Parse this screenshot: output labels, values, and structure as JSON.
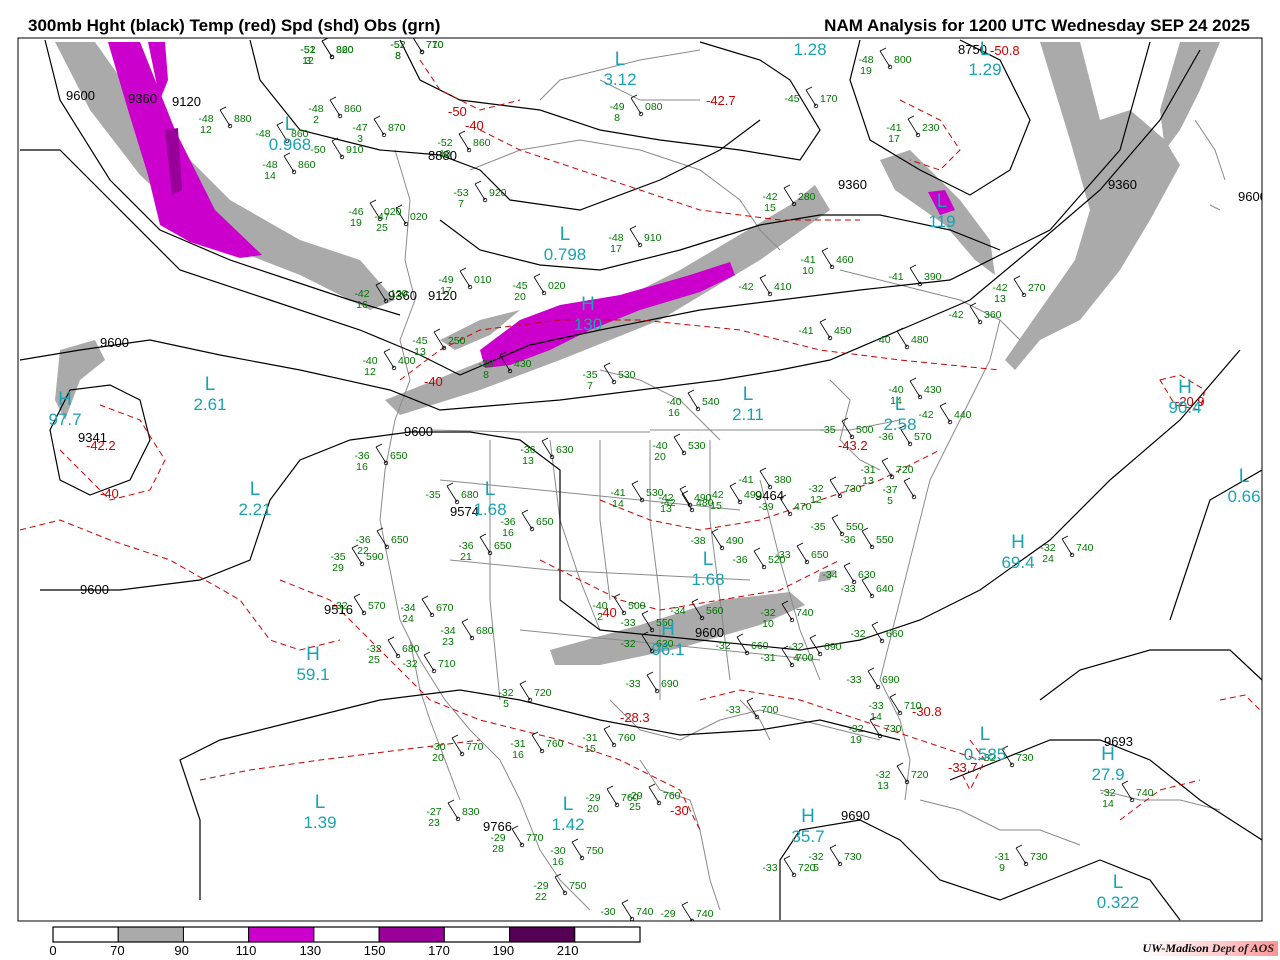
{
  "header": {
    "left_title": "300mb Hght (black) Temp (red) Spd (shd) Obs (grn)",
    "right_title": "NAM Analysis for 1200 UTC Wednesday  SEP 24 2025"
  },
  "credit": {
    "org": "UW-Madison",
    "dept": "Dept of AOS"
  },
  "colors": {
    "height": "#000000",
    "temp": "#cc0000",
    "obs": "#007700",
    "pressure_label": "#1aa3b3",
    "shade70": "#aaaaaa",
    "shade110": "#cc00cc",
    "shade150": "#990099",
    "shade190": "#550055",
    "border": "#888888"
  },
  "colorbar": {
    "ticks": [
      "0",
      "70",
      "90",
      "110",
      "130",
      "150",
      "170",
      "190",
      "210"
    ],
    "bins": [
      "#ffffff",
      "#aaaaaa",
      "#ffffff",
      "#cc00cc",
      "#ffffff",
      "#990099",
      "#ffffff",
      "#550055",
      "#ffffff"
    ]
  },
  "height_labels": [
    "9600",
    "9360",
    "9120",
    "8880",
    "9360",
    "9600",
    "9341",
    "9600",
    "9600",
    "9574",
    "9516",
    "9600",
    "9766",
    "9690",
    "9693",
    "9360",
    "9600",
    "8750",
    "9360",
    "9120",
    "9464"
  ],
  "temp_labels": [
    "-50",
    "-40",
    "-40",
    "-42.2",
    "-40",
    "-30",
    "-28.3",
    "-20.9",
    "-33.7",
    "-30.8",
    "-42.7",
    "-50.8",
    "-43.2",
    "-40"
  ],
  "pressure_centers": [
    {
      "type": "L",
      "value": "2.61"
    },
    {
      "type": "L",
      "value": "2.21"
    },
    {
      "type": "H",
      "value": "59.1"
    },
    {
      "type": "L",
      "value": "1.39"
    },
    {
      "type": "L",
      "value": "1.42"
    },
    {
      "type": "H",
      "value": "35.7"
    },
    {
      "type": "H",
      "value": "96.1"
    },
    {
      "type": "L",
      "value": "1.68"
    },
    {
      "type": "L",
      "value": "1.68"
    },
    {
      "type": "L",
      "value": "2.11"
    },
    {
      "type": "L",
      "value": "2.58"
    },
    {
      "type": "H",
      "value": "69.4"
    },
    {
      "type": "L",
      "value": "0.585"
    },
    {
      "type": "H",
      "value": "27.9"
    },
    {
      "type": "L",
      "value": "0.322"
    },
    {
      "type": "L",
      "value": "0.66"
    },
    {
      "type": "H",
      "value": "90.4"
    },
    {
      "type": "L",
      "value": "1.28"
    },
    {
      "type": "L",
      "value": "1.29"
    },
    {
      "type": "L",
      "value": "0.798"
    },
    {
      "type": "H",
      "value": "130"
    },
    {
      "type": "L",
      "value": "0.968"
    },
    {
      "type": "L",
      "value": "3.12"
    },
    {
      "type": "H",
      "value": "97.7"
    },
    {
      "type": "L",
      "value": "119"
    }
  ],
  "observations": [
    {
      "t": "-51",
      "d": "12",
      "h": "820"
    },
    {
      "t": "-52",
      "d": "8",
      "h": "710"
    },
    {
      "t": "-48",
      "d": "12",
      "h": "880"
    },
    {
      "t": "-48",
      "d": "2",
      "h": "860"
    },
    {
      "t": "-47",
      "d": "3",
      "h": "870"
    },
    {
      "t": "-48",
      "d": "",
      "h": "860"
    },
    {
      "t": "-50",
      "d": "",
      "h": "910"
    },
    {
      "t": "-48",
      "d": "14",
      "h": "860"
    },
    {
      "t": "-52",
      "d": "10",
      "h": "860"
    },
    {
      "t": "-53",
      "d": "7",
      "h": "920"
    },
    {
      "t": "-46",
      "d": "19",
      "h": "020"
    },
    {
      "t": "-47",
      "d": "25",
      "h": "020"
    },
    {
      "t": "-48",
      "d": "17",
      "h": "910"
    },
    {
      "t": "-49",
      "d": "17",
      "h": "010"
    },
    {
      "t": "-45",
      "d": "20",
      "h": "020"
    },
    {
      "t": "-42",
      "d": "16",
      "h": "120"
    },
    {
      "t": "-45",
      "d": "13",
      "h": "250"
    },
    {
      "t": "-40",
      "d": "12",
      "h": "400"
    },
    {
      "t": "-38",
      "d": "8",
      "h": "430"
    },
    {
      "t": "-35",
      "d": "7",
      "h": "530"
    },
    {
      "t": "-40",
      "d": "16",
      "h": "540"
    },
    {
      "t": "-36",
      "d": "16",
      "h": "650"
    },
    {
      "t": "-36",
      "d": "13",
      "h": "630"
    },
    {
      "t": "-35",
      "d": "",
      "h": "680"
    },
    {
      "t": "-36",
      "d": "16",
      "h": "650"
    },
    {
      "t": "-36",
      "d": "21",
      "h": "650"
    },
    {
      "t": "-36",
      "d": "22",
      "h": "650"
    },
    {
      "t": "-35",
      "d": "29",
      "h": "590"
    },
    {
      "t": "-32",
      "d": "",
      "h": "570"
    },
    {
      "t": "-34",
      "d": "24",
      "h": "670"
    },
    {
      "t": "-34",
      "d": "23",
      "h": "680"
    },
    {
      "t": "-32",
      "d": "25",
      "h": "680"
    },
    {
      "t": "-32",
      "d": "",
      "h": "710"
    },
    {
      "t": "-32",
      "d": "5",
      "h": "720"
    },
    {
      "t": "-30",
      "d": "20",
      "h": "770"
    },
    {
      "t": "-31",
      "d": "16",
      "h": "760"
    },
    {
      "t": "-31",
      "d": "15",
      "h": "760"
    },
    {
      "t": "-29",
      "d": "20",
      "h": "760"
    },
    {
      "t": "-29",
      "d": "25",
      "h": "760"
    },
    {
      "t": "-27",
      "d": "23",
      "h": "830"
    },
    {
      "t": "-29",
      "d": "28",
      "h": "770"
    },
    {
      "t": "-30",
      "d": "16",
      "h": "750"
    },
    {
      "t": "-29",
      "d": "22",
      "h": "750"
    },
    {
      "t": "-30",
      "d": "",
      "h": "740"
    },
    {
      "t": "-29",
      "d": "",
      "h": "740"
    },
    {
      "t": "-40",
      "d": "20",
      "h": "530"
    },
    {
      "t": "-41",
      "d": "14",
      "h": "530"
    },
    {
      "t": "-42",
      "d": "13",
      "h": "490"
    },
    {
      "t": "-42",
      "d": "15",
      "h": "490"
    },
    {
      "t": "-41",
      "d": "",
      "h": "380"
    },
    {
      "t": "-39",
      "d": "",
      "h": "470"
    },
    {
      "t": "-38",
      "d": "",
      "h": "490"
    },
    {
      "t": "-36",
      "d": "",
      "h": "520"
    },
    {
      "t": "-42",
      "d": "",
      "h": "480"
    },
    {
      "t": "-40",
      "d": "2",
      "h": "500"
    },
    {
      "t": "-34",
      "d": "",
      "h": "560"
    },
    {
      "t": "-33",
      "d": "",
      "h": "550"
    },
    {
      "t": "-32",
      "d": "",
      "h": "630"
    },
    {
      "t": "-33",
      "d": "",
      "h": "690"
    },
    {
      "t": "-32",
      "d": "",
      "h": "660"
    },
    {
      "t": "-31",
      "d": "",
      "h": "700"
    },
    {
      "t": "-32",
      "d": "4",
      "h": "690"
    },
    {
      "t": "-33",
      "d": "",
      "h": "700"
    },
    {
      "t": "-32",
      "d": "10",
      "h": "740"
    },
    {
      "t": "-33",
      "d": "",
      "h": "650"
    },
    {
      "t": "-35",
      "d": "",
      "h": "550"
    },
    {
      "t": "-36",
      "d": "",
      "h": "550"
    },
    {
      "t": "-34",
      "d": "",
      "h": "630"
    },
    {
      "t": "-33",
      "d": "",
      "h": "640"
    },
    {
      "t": "-32",
      "d": "",
      "h": "660"
    },
    {
      "t": "-33",
      "d": "",
      "h": "690"
    },
    {
      "t": "-33",
      "d": "14",
      "h": "710"
    },
    {
      "t": "-32",
      "d": "19",
      "h": "730"
    },
    {
      "t": "-32",
      "d": "13",
      "h": "720"
    },
    {
      "t": "-33",
      "d": "",
      "h": "720"
    },
    {
      "t": "-32",
      "d": "5",
      "h": "730"
    },
    {
      "t": "-32",
      "d": "24",
      "h": "740"
    },
    {
      "t": "-32",
      "d": "",
      "h": "730"
    },
    {
      "t": "-32",
      "d": "14",
      "h": "740"
    },
    {
      "t": "-31",
      "d": "9",
      "h": "730"
    },
    {
      "t": "-31",
      "d": "13",
      "h": "720"
    },
    {
      "t": "-32",
      "d": "12",
      "h": "730"
    },
    {
      "t": "-37",
      "d": "5",
      "h": ""
    },
    {
      "t": "-35",
      "d": "",
      "h": "500"
    },
    {
      "t": "-36",
      "d": "",
      "h": "570"
    },
    {
      "t": "-42",
      "d": "",
      "h": "440"
    },
    {
      "t": "-40",
      "d": "14",
      "h": "430"
    },
    {
      "t": "-40",
      "d": "",
      "h": "480"
    },
    {
      "t": "-41",
      "d": "",
      "h": "450"
    },
    {
      "t": "-42",
      "d": "",
      "h": "410"
    },
    {
      "t": "-41",
      "d": "10",
      "h": "460"
    },
    {
      "t": "-41",
      "d": "",
      "h": "390"
    },
    {
      "t": "-42",
      "d": "",
      "h": "360"
    },
    {
      "t": "-42",
      "d": "13",
      "h": "270"
    },
    {
      "t": "-42",
      "d": "15",
      "h": "280"
    },
    {
      "t": "-41",
      "d": "17",
      "h": "230"
    },
    {
      "t": "-45",
      "d": "",
      "h": "170"
    },
    {
      "t": "-48",
      "d": "19",
      "h": "800"
    },
    {
      "t": "-49",
      "d": "8",
      "h": "080"
    },
    {
      "t": "-52",
      "d": "3",
      "h": "860"
    },
    {
      "t": "-52",
      "d": "8",
      "h": "770"
    }
  ]
}
